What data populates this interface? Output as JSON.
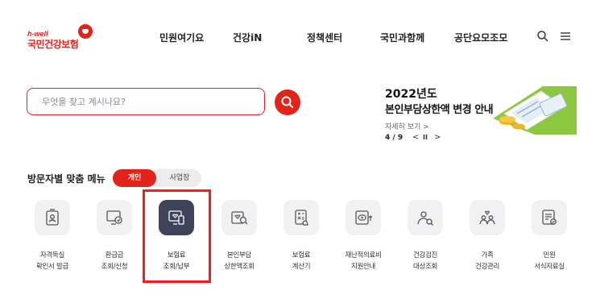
{
  "logo": {
    "small_text": "h-well",
    "main_text": "국민건강보험"
  },
  "nav": {
    "items": [
      "민원여기요",
      "건강iN",
      "정책센터",
      "국민과함께",
      "공단요모조모"
    ],
    "icons": [
      "search-icon",
      "menu-icon"
    ]
  },
  "search": {
    "placeholder": "무엇을 찾고 계시나요?",
    "value": "",
    "button_icon": "search-icon"
  },
  "banner": {
    "year": "2022년도",
    "title": "본인부담상한액 변경 안내",
    "more": "자세히 보기 >",
    "page": "4 / 9",
    "prev": "<",
    "pause": "II",
    "next": ">"
  },
  "visitor_menu": {
    "title": "방문자별 맞춤 메뉴",
    "toggle": {
      "personal": "개인",
      "business": "사업장",
      "selected": "personal"
    },
    "items": [
      {
        "line1": "자격득실",
        "line2": "확인서 발급",
        "icon": "certificate-icon"
      },
      {
        "line1": "환급금",
        "line2": "조회/신청",
        "icon": "refund-monitor-icon"
      },
      {
        "line1": "보험료",
        "line2": "조회/납부",
        "icon": "premium-payment-icon",
        "active": true
      },
      {
        "line1": "본인부담",
        "line2": "상한액조회",
        "icon": "ceiling-search-icon"
      },
      {
        "line1": "보험료",
        "line2": "계산기",
        "icon": "calculator-icon"
      },
      {
        "line1": "재난적의료비",
        "line2": "지원안내",
        "icon": "medical-support-icon"
      },
      {
        "line1": "건강검진",
        "line2": "대상조회",
        "icon": "checkup-search-icon"
      },
      {
        "line1": "가족",
        "line2": "건강관리",
        "icon": "family-care-icon"
      },
      {
        "line1": "민원",
        "line2": "서식자료실",
        "icon": "form-library-icon"
      }
    ]
  },
  "colors": {
    "brand": "#e2231a",
    "active_icon_bg": "#3f4359",
    "icon_bg": "#f1f1f3",
    "highlight": "#ff1a1a"
  }
}
